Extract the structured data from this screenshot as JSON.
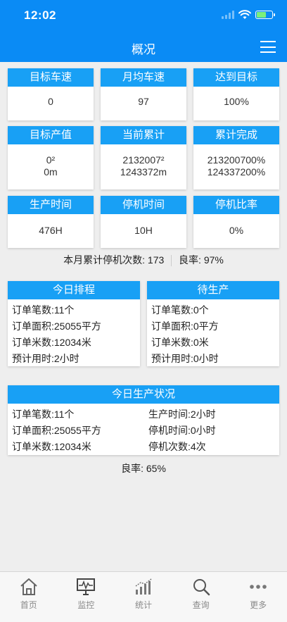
{
  "status": {
    "time": "12:02"
  },
  "nav": {
    "title": "概况"
  },
  "kpi": [
    {
      "label": "目标车速",
      "value": "0"
    },
    {
      "label": "月均车速",
      "value": "97"
    },
    {
      "label": "达到目标",
      "value": "100%"
    },
    {
      "label": "目标产值",
      "value": "0²",
      "value2": "0m"
    },
    {
      "label": "当前累计",
      "value": "2132007²",
      "value2": "1243372m"
    },
    {
      "label": "累计完成",
      "value": "213200700%",
      "value2": "124337200%"
    },
    {
      "label": "生产时间",
      "value": "476H"
    },
    {
      "label": "停机时间",
      "value": "10H"
    },
    {
      "label": "停机比率",
      "value": "0%"
    }
  ],
  "summary": {
    "stop_count_label": "本月累计停机次数:",
    "stop_count": "173",
    "yield_label": "良率:",
    "yield": "97%"
  },
  "today_schedule": {
    "title": "今日排程",
    "rows": [
      {
        "label": "订单笔数:",
        "value": "11个"
      },
      {
        "label": "订单面积:",
        "value": "25055平方"
      },
      {
        "label": "订单米数:",
        "value": "12034米"
      },
      {
        "label": "预计用时:",
        "value": "2小时"
      }
    ]
  },
  "pending": {
    "title": "待生产",
    "rows": [
      {
        "label": "订单笔数:",
        "value": "0个"
      },
      {
        "label": "订单面积:",
        "value": "0平方"
      },
      {
        "label": "订单米数:",
        "value": "0米"
      },
      {
        "label": "预计用时:",
        "value": "0小时"
      }
    ]
  },
  "today_status": {
    "title": "今日生产状况",
    "left": [
      {
        "label": "订单笔数:",
        "value": "11个"
      },
      {
        "label": "订单面积:",
        "value": "25055平方"
      },
      {
        "label": "订单米数:",
        "value": "12034米"
      }
    ],
    "right": [
      {
        "label": "生产时间:",
        "value": "2小时"
      },
      {
        "label": "停机时间:",
        "value": "0小时"
      },
      {
        "label": "停机次数:",
        "value": "4次"
      }
    ],
    "yield_label": "良率:",
    "yield": "65%"
  },
  "tabs": [
    {
      "label": "首页",
      "icon": "home-icon"
    },
    {
      "label": "监控",
      "icon": "monitor-icon"
    },
    {
      "label": "统计",
      "icon": "chart-icon"
    },
    {
      "label": "查询",
      "icon": "search-icon"
    },
    {
      "label": "更多",
      "icon": "more-icon"
    }
  ],
  "colors": {
    "primary": "#0a8bf5",
    "header": "#18a0f5",
    "background": "#eeeeee"
  }
}
